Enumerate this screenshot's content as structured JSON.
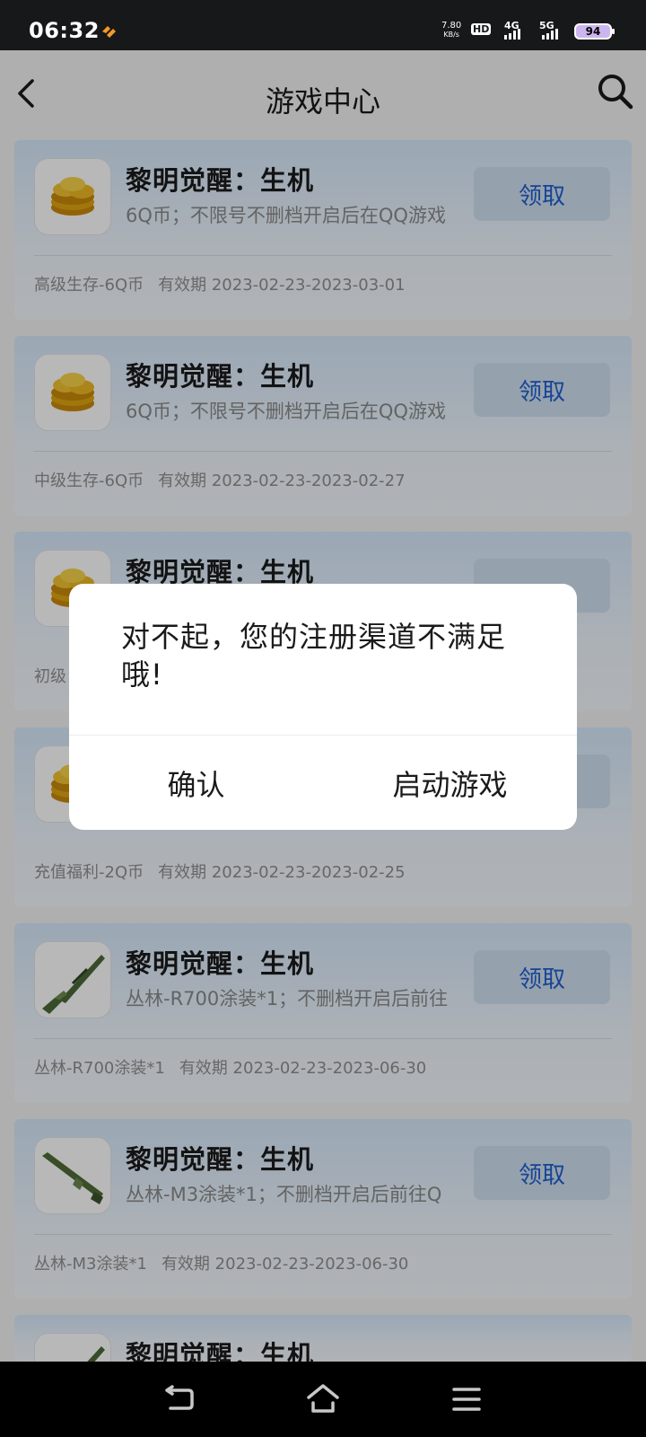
{
  "status_bar": {
    "time": "06:32",
    "speed_value": "7.80",
    "speed_unit": "KB/s",
    "hd_label": "HD",
    "net_4g": "4G",
    "net_5g": "5G",
    "battery": "94"
  },
  "header": {
    "title": "游戏中心"
  },
  "cards": [
    {
      "title": "黎明觉醒：生机",
      "desc": "6Q币；不限号不删档开启后在QQ游戏",
      "button": "领取",
      "meta_name": "高级生存-6Q币",
      "meta_validity": "有效期 2023-02-23-2023-03-01",
      "icon": "gold-coins-icon"
    },
    {
      "title": "黎明觉醒：生机",
      "desc": "6Q币；不限号不删档开启后在QQ游戏",
      "button": "领取",
      "meta_name": "中级生存-6Q币",
      "meta_validity": "有效期 2023-02-23-2023-02-27",
      "icon": "gold-coins-icon"
    },
    {
      "title": "黎明觉醒：生机",
      "desc": "",
      "button": "",
      "meta_name": "初级",
      "meta_validity": "",
      "icon": "gold-coins-icon"
    },
    {
      "title": "",
      "desc": "",
      "button": "",
      "meta_name": "充值福利-2Q币",
      "meta_validity": "有效期 2023-02-23-2023-02-25",
      "icon": "gold-coins-icon"
    },
    {
      "title": "黎明觉醒：生机",
      "desc": "丛林-R700涂装*1；不删档开启后前往",
      "button": "领取",
      "meta_name": "丛林-R700涂装*1",
      "meta_validity": "有效期 2023-02-23-2023-06-30",
      "icon": "rifle-skin-icon"
    },
    {
      "title": "黎明觉醒：生机",
      "desc": "丛林-M3涂装*1；不删档开启后前往Q",
      "button": "领取",
      "meta_name": "丛林-M3涂装*1",
      "meta_validity": "有效期 2023-02-23-2023-06-30",
      "icon": "shotgun-skin-icon"
    },
    {
      "title": "黎明觉醒：生机",
      "desc": "",
      "button": "",
      "meta_name": "",
      "meta_validity": "",
      "icon": "rifle-skin-icon"
    }
  ],
  "dialog": {
    "message": "对不起，您的注册渠道不满足哦!",
    "confirm_label": "确认",
    "launch_label": "启动游戏"
  },
  "nav_bar": {
    "back": "back-nav-icon",
    "home": "home-icon",
    "menu": "menu-icon"
  }
}
